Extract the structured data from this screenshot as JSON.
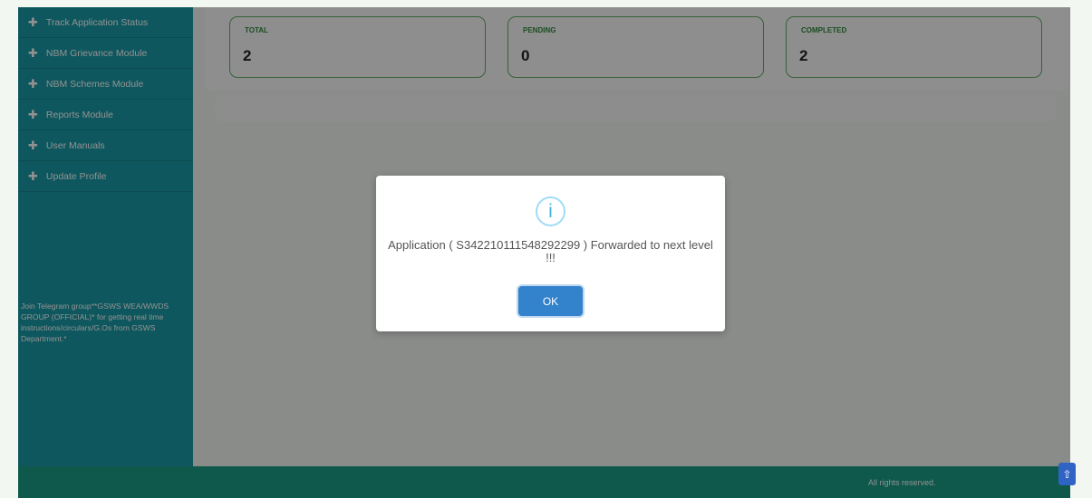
{
  "sidebar": {
    "items": [
      {
        "label": "Track Application Status"
      },
      {
        "label": "NBM Grievance Module"
      },
      {
        "label": "NBM Schemes Module"
      },
      {
        "label": "Reports Module"
      },
      {
        "label": "User Manuals"
      },
      {
        "label": "Update Profile"
      }
    ],
    "note": "Join Telegram group**GSWS WEA/WWDS GROUP (OFFICIAL)* for getting real time instructions/circulars/G.Os from GSWS Department.*"
  },
  "stats": [
    {
      "label": "TOTAL",
      "value": "2"
    },
    {
      "label": "PENDING",
      "value": "0"
    },
    {
      "label": "COMPLETED",
      "value": "2"
    }
  ],
  "footer": {
    "text": "All rights reserved."
  },
  "modal": {
    "icon": "info-icon",
    "icon_glyph": "i",
    "message": "Application ( S342210111548292299 ) Forwarded to next level !!!",
    "ok_label": "OK"
  },
  "scroll_top_glyph": "⇧",
  "colors": {
    "sidebar": "#1a9aa5",
    "footer": "#1a9c86",
    "stat_border": "#62ad64",
    "ok_button": "#3282cc",
    "info_icon": "#3fb6e6"
  }
}
